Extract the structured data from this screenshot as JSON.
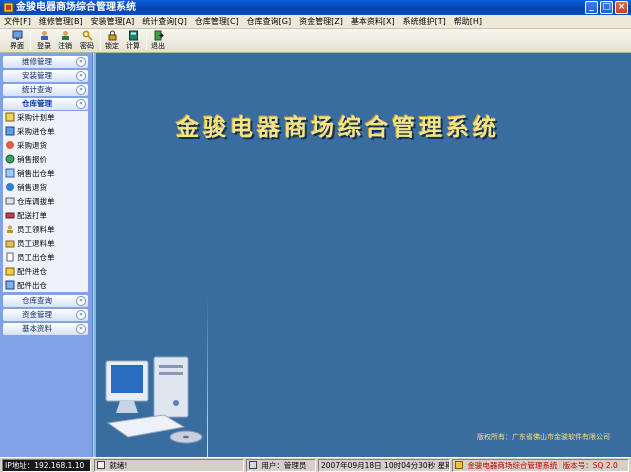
{
  "window": {
    "title": "金骏电器商场综合管理系统",
    "min_glyph": "_",
    "max_glyph": "□",
    "close_glyph": "×"
  },
  "menu": [
    "文件[F]",
    "维修管理[B]",
    "安装管理[A]",
    "统计查询[Q]",
    "仓库管理[C]",
    "仓库查询[G]",
    "资金管理[Z]",
    "基本资料[X]",
    "系统维护[T]",
    "帮助[H]"
  ],
  "toolbar": {
    "items": [
      {
        "label": "界面",
        "icon": "monitor-icon"
      },
      {
        "label": "登录",
        "icon": "login-icon"
      },
      {
        "label": "注销",
        "icon": "logout-icon"
      },
      {
        "label": "密码",
        "icon": "key-icon"
      },
      {
        "label": "锁定",
        "icon": "lock-icon"
      },
      {
        "label": "计算",
        "icon": "calculator-icon"
      },
      {
        "label": "退出",
        "icon": "exit-icon"
      }
    ]
  },
  "sidebar": {
    "chevron_down": "»",
    "chevron_up": "«",
    "groups_top": [
      "维修管理",
      "安装管理",
      "统计查询"
    ],
    "active_group": "仓库管理",
    "items": [
      "采购计划单",
      "采购进仓单",
      "采购退货",
      "销售报价",
      "销售出仓单",
      "销售退货",
      "仓库调拔单",
      "配送打单",
      "员工领料单",
      "员工退料单",
      "员工出仓单",
      "配件进仓",
      "配件出仓"
    ],
    "groups_bottom": [
      "仓库查询",
      "资金管理",
      "基本资料"
    ]
  },
  "main": {
    "headline": "金骏电器商场综合管理系统",
    "copyright": "版权所有：广东省佛山市金骏软件有限公司"
  },
  "status": {
    "ip": "IP地址：192.168.1.10",
    "ready": "就绪!",
    "user": "用户：管理员",
    "datetime": "2007年09月18日  10时04分30秒  星期二",
    "app_name": "金骏电器商场综合管理系统",
    "version": "版本号：SQ 2.0"
  },
  "colors": {
    "main_bg": "#3a6d9f",
    "sidebar_bg": "#7fa3e6",
    "headline": "#f3e48a"
  }
}
